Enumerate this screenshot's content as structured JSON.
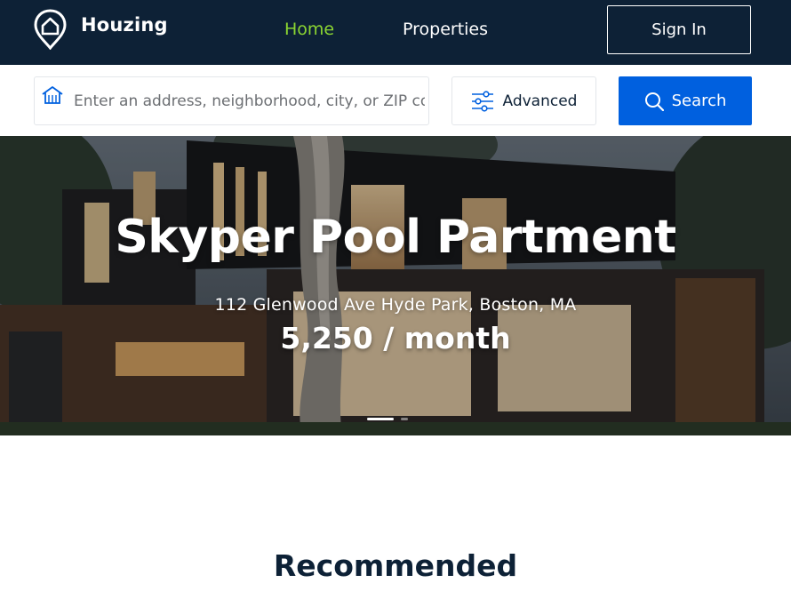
{
  "brand": {
    "name": "Houzing",
    "icon": "house-pin-icon"
  },
  "nav": {
    "home": "Home",
    "properties": "Properties",
    "sign_in": "Sign In"
  },
  "search": {
    "placeholder": "Enter an address, neighborhood, city, or ZIP code",
    "value": "",
    "advanced_label": "Advanced",
    "search_label": "Search"
  },
  "hero": {
    "title": "Skyper Pool Partment",
    "address": "112 Glenwood Ave Hyde Park, Boston, MA",
    "price": "5,250 / month",
    "slide_count": 2,
    "active_slide": 1
  },
  "recommended": {
    "title": "Recommended"
  },
  "colors": {
    "navbar": "#0d2136",
    "active_nav": "#8bd532",
    "primary": "#0060df",
    "heading": "#0d2136"
  }
}
